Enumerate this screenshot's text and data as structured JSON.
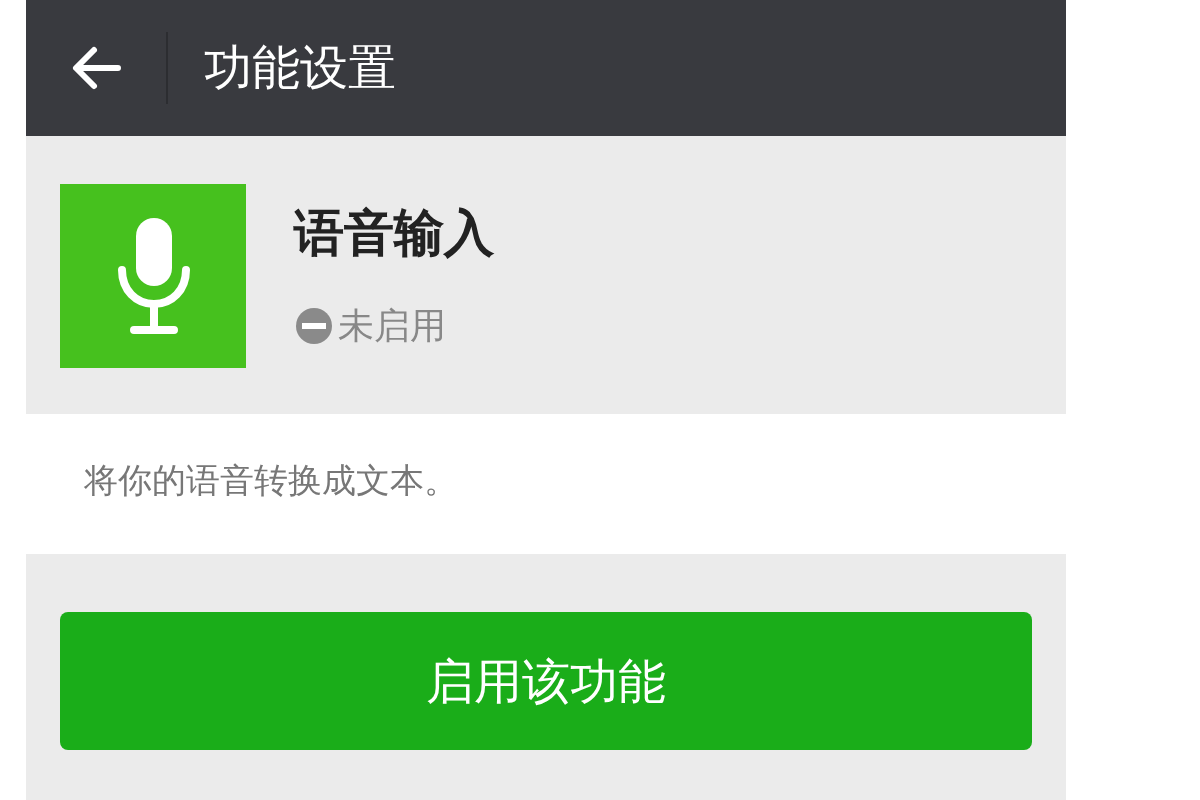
{
  "header": {
    "title": "功能设置"
  },
  "feature": {
    "name": "语音输入",
    "status": {
      "text": "未启用",
      "enabled": false
    }
  },
  "description": "将你的语音转换成文本。",
  "action_button": {
    "label": "启用该功能"
  }
}
